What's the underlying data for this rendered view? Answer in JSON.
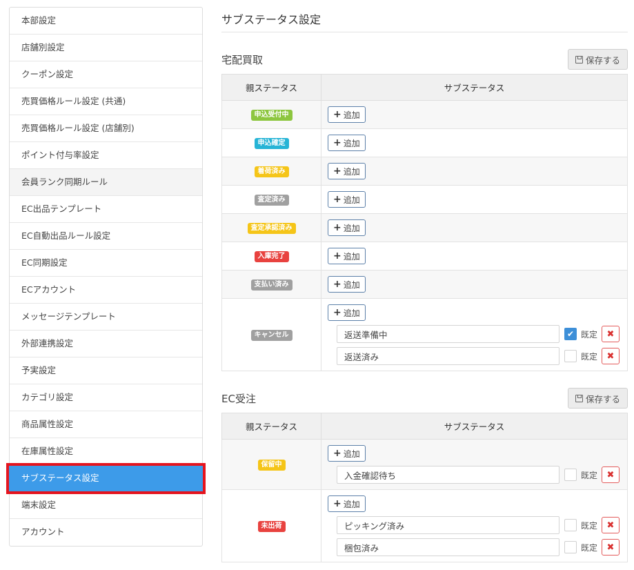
{
  "sidebar": {
    "items": [
      {
        "label": "本部設定",
        "state": "normal"
      },
      {
        "label": "店舗別設定",
        "state": "normal"
      },
      {
        "label": "クーポン設定",
        "state": "normal"
      },
      {
        "label": "売買価格ルール設定 (共通)",
        "state": "normal"
      },
      {
        "label": "売買価格ルール設定 (店舗別)",
        "state": "normal"
      },
      {
        "label": "ポイント付与率設定",
        "state": "normal"
      },
      {
        "label": "会員ランク同期ルール",
        "state": "shaded"
      },
      {
        "label": "EC出品テンプレート",
        "state": "normal"
      },
      {
        "label": "EC自動出品ルール設定",
        "state": "normal"
      },
      {
        "label": "EC同期設定",
        "state": "normal"
      },
      {
        "label": "ECアカウント",
        "state": "normal"
      },
      {
        "label": "メッセージテンプレート",
        "state": "normal"
      },
      {
        "label": "外部連携設定",
        "state": "normal"
      },
      {
        "label": "予実設定",
        "state": "normal"
      },
      {
        "label": "カテゴリ設定",
        "state": "normal"
      },
      {
        "label": "商品属性設定",
        "state": "normal"
      },
      {
        "label": "在庫属性設定",
        "state": "normal"
      },
      {
        "label": "サブステータス設定",
        "state": "active"
      },
      {
        "label": "端末設定",
        "state": "normal"
      },
      {
        "label": "アカウント",
        "state": "normal"
      }
    ]
  },
  "page": {
    "title": "サブステータス設定"
  },
  "labels": {
    "save": "保存する",
    "add": "追加",
    "default": "既定",
    "col_parent": "親ステータス",
    "col_sub": "サブステータス"
  },
  "sections": [
    {
      "title": "宅配買取",
      "rows": [
        {
          "status": "申込受付中",
          "color": "#8dc63f",
          "subs": []
        },
        {
          "status": "申込確定",
          "color": "#26b4d6",
          "subs": []
        },
        {
          "status": "着荷済み",
          "color": "#f5c518",
          "subs": []
        },
        {
          "status": "査定済み",
          "color": "#a0a0a0",
          "subs": []
        },
        {
          "status": "査定承認済み",
          "color": "#f5c518",
          "subs": []
        },
        {
          "status": "入庫完了",
          "color": "#e8423f",
          "subs": []
        },
        {
          "status": "支払い済み",
          "color": "#a0a0a0",
          "subs": []
        },
        {
          "status": "キャンセル",
          "color": "#a0a0a0",
          "subs": [
            {
              "value": "返送準備中",
              "default": true
            },
            {
              "value": "返送済み",
              "default": false
            }
          ]
        }
      ]
    },
    {
      "title": "EC受注",
      "rows": [
        {
          "status": "保留中",
          "color": "#f5c518",
          "subs": [
            {
              "value": "入金確認待ち",
              "default": false
            }
          ]
        },
        {
          "status": "未出荷",
          "color": "#e8423f",
          "subs": [
            {
              "value": "ピッキング済み",
              "default": false
            },
            {
              "value": "梱包済み",
              "default": false
            }
          ]
        }
      ]
    }
  ]
}
